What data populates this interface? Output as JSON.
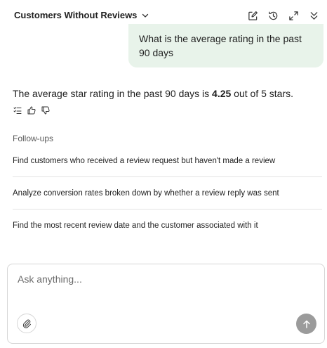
{
  "header": {
    "title": "Customers Without Reviews",
    "icons": [
      "chevron-down-icon",
      "edit-icon",
      "history-icon",
      "expand-icon",
      "collapse-icon"
    ]
  },
  "conversation": {
    "user_message": "What is the average rating in the past 90 days",
    "assistant_prefix": "The average star rating in the past 90 days is ",
    "assistant_value": "4.25",
    "assistant_suffix": " out of 5 stars.",
    "feedback_icons": [
      "list-icon",
      "thumbs-up-icon",
      "thumbs-down-icon"
    ]
  },
  "followups": {
    "label": "Follow-ups",
    "items": [
      "Find customers who received a review request but haven't made a review",
      "Analyze conversion rates broken down by whether a review reply was sent",
      "Find the most recent review date and the customer associated with it"
    ]
  },
  "composer": {
    "placeholder": "Ask anything...",
    "value": "",
    "attach_icon": "paperclip-icon",
    "send_icon": "arrow-up-icon"
  },
  "colors": {
    "bubble_bg": "#e8f3ea",
    "send_button": "#9b9b9b",
    "divider": "#e4e4e4"
  }
}
